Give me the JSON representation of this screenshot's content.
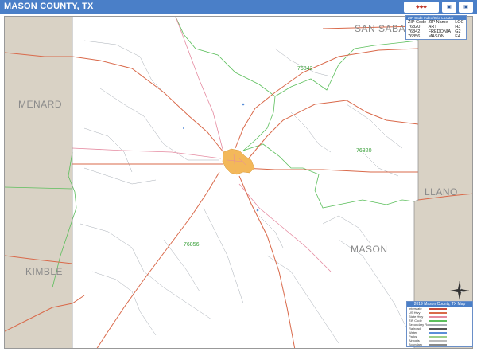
{
  "header": {
    "title": "MASON COUNTY, TX",
    "brand_logo": "map-sales-logo",
    "brand_colors": {
      "bar": "#4a7fc8",
      "logo_red": "#c0392b"
    }
  },
  "map": {
    "background_color": "#ffffff",
    "neighbor_county_color": "#d9d2c5",
    "highway_color": "#d9694a",
    "zip_boundary_color": "#5cbf5c",
    "local_road_color": "#9aa0a8",
    "city_fill_color": "#f3b85a",
    "neighbor_counties": [
      {
        "name": "SAN SABA"
      },
      {
        "name": "MENARD"
      },
      {
        "name": "LLANO"
      },
      {
        "name": "KIMBLE"
      }
    ],
    "county_label": "MASON",
    "zip_labels": [
      "76842",
      "76820",
      "76856"
    ]
  },
  "zip_table": {
    "header": "ZIP Code Index/Grid Locator",
    "columns": [
      "ZIP Code",
      "ZIP Name",
      "LOC"
    ],
    "rows": [
      {
        "zip": "76820",
        "name": "ART",
        "loc": "H3"
      },
      {
        "zip": "76842",
        "name": "FREDONIA",
        "loc": "G2"
      },
      {
        "zip": "76856",
        "name": "MASON",
        "loc": "E4"
      }
    ]
  },
  "legend": {
    "title": "2019 Mason County, TX Map",
    "rows": [
      "Interstate",
      "US Hwy",
      "State Hwy",
      "ZIP Code",
      "Secondary Roads",
      "Railroad",
      "Water",
      "Parks",
      "Airports",
      "Boundary"
    ],
    "compass_icon": "north-arrow-icon"
  }
}
